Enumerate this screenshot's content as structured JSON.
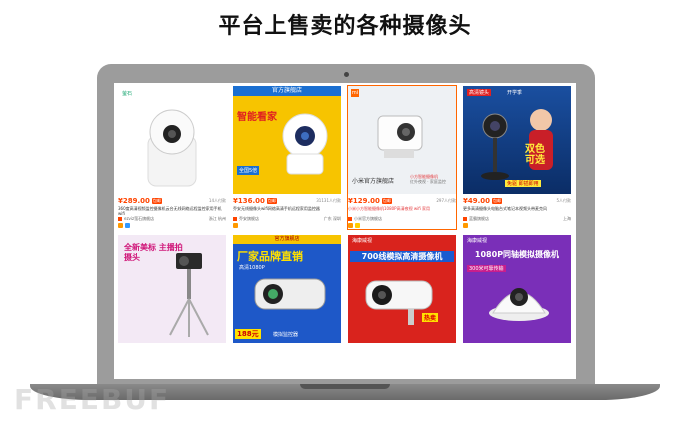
{
  "title": "平台上售卖的各种摄像头",
  "watermark": "FREEBUF",
  "products": [
    {
      "price": "¥289.00",
      "sales": "14人付款",
      "desc": "360度高清视频监控摄像机云台无线网络远程监控家用手机wifi",
      "shop": "ezviz萤石旗舰店",
      "loc": "浙江 杭州",
      "brand": "萤石",
      "accent": "#ffffff"
    },
    {
      "price": "¥136.00",
      "sales": "31131人付款",
      "desc": "乔安无线摄像头wifi网络高清手机远程家用监控器",
      "shop": "乔安旗舰店",
      "loc": "广东 深圳",
      "banner": "官方旗舰店",
      "ad1": "智能看家",
      "ad2": "全国5倍",
      "accent": "#f7c400"
    },
    {
      "price": "¥129.00",
      "sales": "297人付款",
      "desc": "小米小方智能摄像机1080P高清夜视 wifi 家用",
      "shop": "小米官方旗舰店",
      "loc": "",
      "overlay": "小米官方旗舰店",
      "cap1": "小方智能摄像机",
      "cap2": "红外夜视 · 家庭监控",
      "accent": "#f1f1f1"
    },
    {
      "price": "¥49.00",
      "sales": "5人付款",
      "desc": "更多高清摄像头电脑台式笔记本视频头带麦克风",
      "shop": "蓝霸旗舰店",
      "loc": "上海",
      "t1": "高清镜头",
      "t2": "开学季",
      "t3": "双色",
      "t4": "可选",
      "t5": "免驱 即插即用",
      "accent": "#1a4fa0"
    },
    {
      "ad": "全新美标 主播拍摄头",
      "accent": "#f3e9f5"
    },
    {
      "banner": "官方旗舰店",
      "ad": "厂家品牌直销",
      "sub": "高清1080P",
      "strip": "模拟监控器",
      "price": "188元",
      "accent": "#1e58c8"
    },
    {
      "banner": "海康威视",
      "ad": "700线模拟高清摄像机",
      "strip": "热卖",
      "accent": "#d9231d"
    },
    {
      "banner": "海康威视",
      "ad": "1080P同轴模拟摄像机",
      "sub": "300米可靠传输",
      "accent": "#7a2fb8"
    }
  ]
}
